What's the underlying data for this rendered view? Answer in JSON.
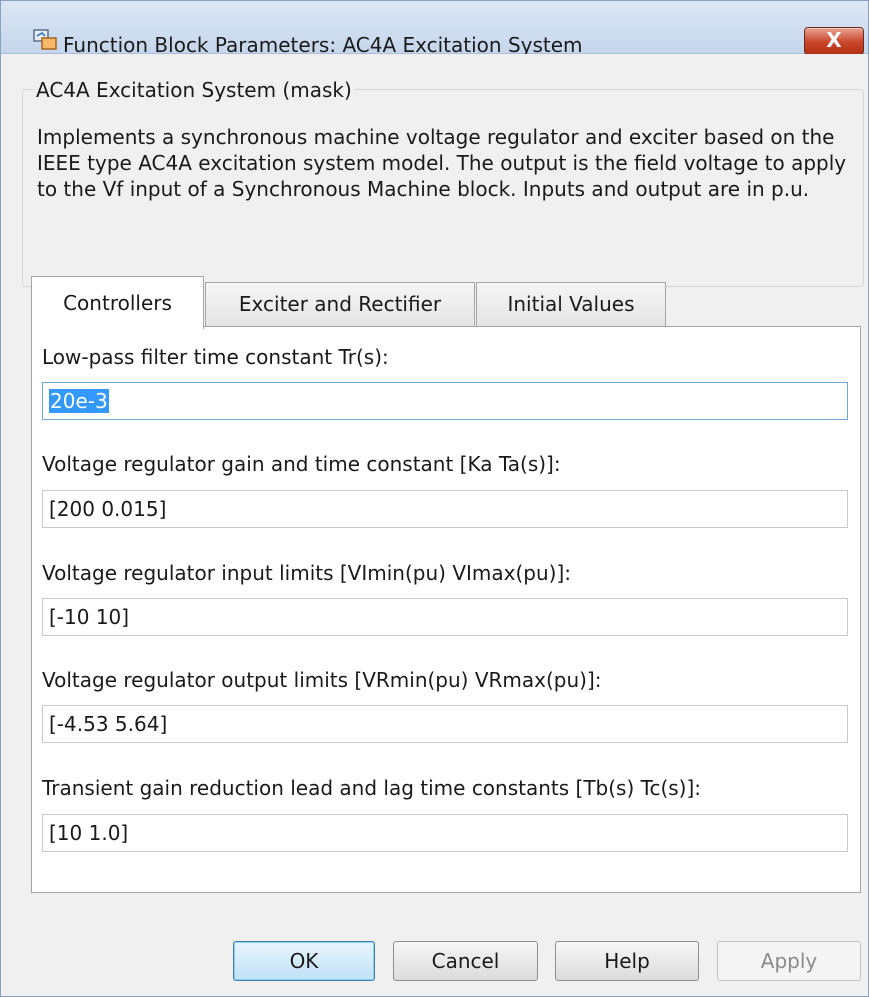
{
  "window": {
    "title": "Function Block Parameters: AC4A Excitation System",
    "close_symbol": "X",
    "icon": "simulink-block-icon"
  },
  "mask": {
    "group_title": "AC4A Excitation System (mask)",
    "description": "Implements a synchronous machine voltage regulator and exciter based on the IEEE type AC4A excitation system model. The output is the field voltage to apply to the Vf input of a Synchronous Machine block. Inputs and output are in p.u."
  },
  "tabs": [
    {
      "label": "Controllers",
      "active": true
    },
    {
      "label": "Exciter and Rectifier",
      "active": false
    },
    {
      "label": "Initial Values",
      "active": false
    }
  ],
  "fields": [
    {
      "label": "Low-pass filter time constant Tr(s):",
      "value": "20e-3"
    },
    {
      "label": "Voltage regulator gain and time constant [Ka Ta(s)]:",
      "value": "[200 0.015]"
    },
    {
      "label": "Voltage regulator input limits [VImin(pu) VImax(pu)]:",
      "value": "[-10 10]"
    },
    {
      "label": "Voltage regulator output limits [VRmin(pu) VRmax(pu)]:",
      "value": "[-4.53 5.64]"
    },
    {
      "label": "Transient gain reduction lead and lag time constants [Tb(s) Tc(s)]:",
      "value": "[10 1.0]"
    }
  ],
  "buttons": {
    "ok": "OK",
    "cancel": "Cancel",
    "help": "Help",
    "apply": "Apply"
  },
  "colors": {
    "selection": "#3399ff",
    "close_button": "#c9452a",
    "default_button": "#bfe1f8"
  }
}
